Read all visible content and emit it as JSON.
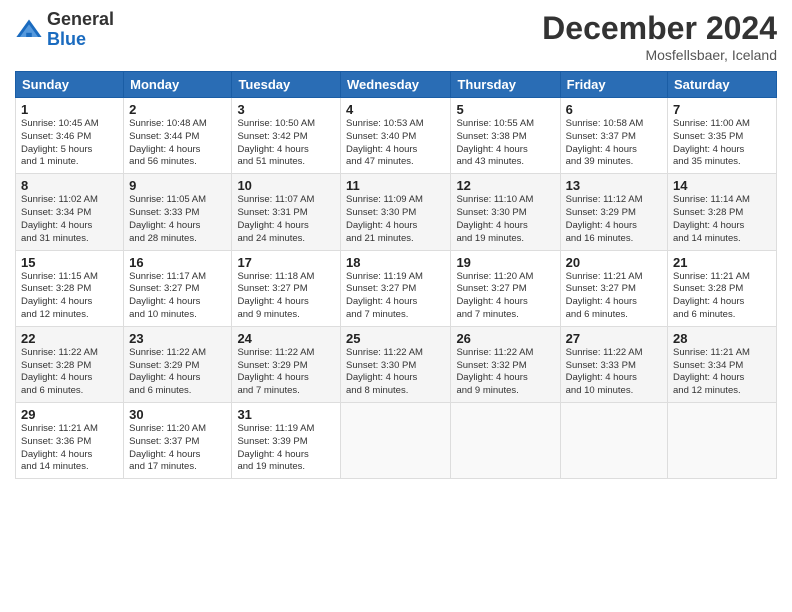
{
  "logo": {
    "general": "General",
    "blue": "Blue"
  },
  "title": "December 2024",
  "location": "Mosfellsbaer, Iceland",
  "weekdays": [
    "Sunday",
    "Monday",
    "Tuesday",
    "Wednesday",
    "Thursday",
    "Friday",
    "Saturday"
  ],
  "weeks": [
    [
      {
        "day": "1",
        "info": "Sunrise: 10:45 AM\nSunset: 3:46 PM\nDaylight: 5 hours\nand 1 minute."
      },
      {
        "day": "2",
        "info": "Sunrise: 10:48 AM\nSunset: 3:44 PM\nDaylight: 4 hours\nand 56 minutes."
      },
      {
        "day": "3",
        "info": "Sunrise: 10:50 AM\nSunset: 3:42 PM\nDaylight: 4 hours\nand 51 minutes."
      },
      {
        "day": "4",
        "info": "Sunrise: 10:53 AM\nSunset: 3:40 PM\nDaylight: 4 hours\nand 47 minutes."
      },
      {
        "day": "5",
        "info": "Sunrise: 10:55 AM\nSunset: 3:38 PM\nDaylight: 4 hours\nand 43 minutes."
      },
      {
        "day": "6",
        "info": "Sunrise: 10:58 AM\nSunset: 3:37 PM\nDaylight: 4 hours\nand 39 minutes."
      },
      {
        "day": "7",
        "info": "Sunrise: 11:00 AM\nSunset: 3:35 PM\nDaylight: 4 hours\nand 35 minutes."
      }
    ],
    [
      {
        "day": "8",
        "info": "Sunrise: 11:02 AM\nSunset: 3:34 PM\nDaylight: 4 hours\nand 31 minutes."
      },
      {
        "day": "9",
        "info": "Sunrise: 11:05 AM\nSunset: 3:33 PM\nDaylight: 4 hours\nand 28 minutes."
      },
      {
        "day": "10",
        "info": "Sunrise: 11:07 AM\nSunset: 3:31 PM\nDaylight: 4 hours\nand 24 minutes."
      },
      {
        "day": "11",
        "info": "Sunrise: 11:09 AM\nSunset: 3:30 PM\nDaylight: 4 hours\nand 21 minutes."
      },
      {
        "day": "12",
        "info": "Sunrise: 11:10 AM\nSunset: 3:30 PM\nDaylight: 4 hours\nand 19 minutes."
      },
      {
        "day": "13",
        "info": "Sunrise: 11:12 AM\nSunset: 3:29 PM\nDaylight: 4 hours\nand 16 minutes."
      },
      {
        "day": "14",
        "info": "Sunrise: 11:14 AM\nSunset: 3:28 PM\nDaylight: 4 hours\nand 14 minutes."
      }
    ],
    [
      {
        "day": "15",
        "info": "Sunrise: 11:15 AM\nSunset: 3:28 PM\nDaylight: 4 hours\nand 12 minutes."
      },
      {
        "day": "16",
        "info": "Sunrise: 11:17 AM\nSunset: 3:27 PM\nDaylight: 4 hours\nand 10 minutes."
      },
      {
        "day": "17",
        "info": "Sunrise: 11:18 AM\nSunset: 3:27 PM\nDaylight: 4 hours\nand 9 minutes."
      },
      {
        "day": "18",
        "info": "Sunrise: 11:19 AM\nSunset: 3:27 PM\nDaylight: 4 hours\nand 7 minutes."
      },
      {
        "day": "19",
        "info": "Sunrise: 11:20 AM\nSunset: 3:27 PM\nDaylight: 4 hours\nand 7 minutes."
      },
      {
        "day": "20",
        "info": "Sunrise: 11:21 AM\nSunset: 3:27 PM\nDaylight: 4 hours\nand 6 minutes."
      },
      {
        "day": "21",
        "info": "Sunrise: 11:21 AM\nSunset: 3:28 PM\nDaylight: 4 hours\nand 6 minutes."
      }
    ],
    [
      {
        "day": "22",
        "info": "Sunrise: 11:22 AM\nSunset: 3:28 PM\nDaylight: 4 hours\nand 6 minutes."
      },
      {
        "day": "23",
        "info": "Sunrise: 11:22 AM\nSunset: 3:29 PM\nDaylight: 4 hours\nand 6 minutes."
      },
      {
        "day": "24",
        "info": "Sunrise: 11:22 AM\nSunset: 3:29 PM\nDaylight: 4 hours\nand 7 minutes."
      },
      {
        "day": "25",
        "info": "Sunrise: 11:22 AM\nSunset: 3:30 PM\nDaylight: 4 hours\nand 8 minutes."
      },
      {
        "day": "26",
        "info": "Sunrise: 11:22 AM\nSunset: 3:32 PM\nDaylight: 4 hours\nand 9 minutes."
      },
      {
        "day": "27",
        "info": "Sunrise: 11:22 AM\nSunset: 3:33 PM\nDaylight: 4 hours\nand 10 minutes."
      },
      {
        "day": "28",
        "info": "Sunrise: 11:21 AM\nSunset: 3:34 PM\nDaylight: 4 hours\nand 12 minutes."
      }
    ],
    [
      {
        "day": "29",
        "info": "Sunrise: 11:21 AM\nSunset: 3:36 PM\nDaylight: 4 hours\nand 14 minutes."
      },
      {
        "day": "30",
        "info": "Sunrise: 11:20 AM\nSunset: 3:37 PM\nDaylight: 4 hours\nand 17 minutes."
      },
      {
        "day": "31",
        "info": "Sunrise: 11:19 AM\nSunset: 3:39 PM\nDaylight: 4 hours\nand 19 minutes."
      },
      null,
      null,
      null,
      null
    ]
  ]
}
